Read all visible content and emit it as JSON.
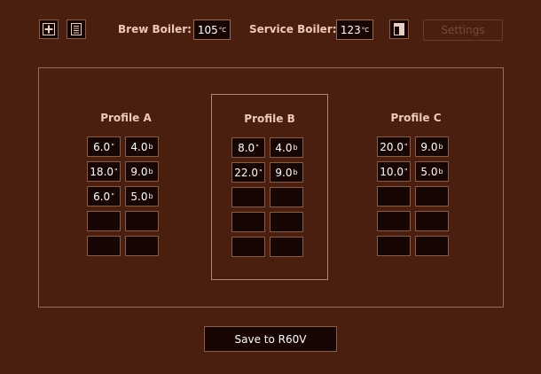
{
  "toolbar": {
    "add_icon": "plus-icon",
    "list_icon": "list-icon",
    "brew_boiler_label": "Brew Boiler:",
    "brew_boiler_value": "105",
    "brew_boiler_unit": "°C",
    "service_boiler_label": "Service Boiler:",
    "service_boiler_value": "123",
    "service_boiler_unit": "°C",
    "panel_icon": "sidebar-panel-icon",
    "settings_label": "Settings"
  },
  "profiles": [
    {
      "title": "Profile A",
      "selected": false,
      "rows": [
        {
          "time": "6.0",
          "time_unit": "\"",
          "pressure": "4.0",
          "pressure_unit": "b"
        },
        {
          "time": "18.0",
          "time_unit": "\"",
          "pressure": "9.0",
          "pressure_unit": "b"
        },
        {
          "time": "6.0",
          "time_unit": "\"",
          "pressure": "5.0",
          "pressure_unit": "b"
        },
        {
          "time": "",
          "time_unit": "",
          "pressure": "",
          "pressure_unit": ""
        },
        {
          "time": "",
          "time_unit": "",
          "pressure": "",
          "pressure_unit": ""
        }
      ]
    },
    {
      "title": "Profile B",
      "selected": true,
      "rows": [
        {
          "time": "8.0",
          "time_unit": "\"",
          "pressure": "4.0",
          "pressure_unit": "b"
        },
        {
          "time": "22.0",
          "time_unit": "\"",
          "pressure": "9.0",
          "pressure_unit": "b"
        },
        {
          "time": "",
          "time_unit": "",
          "pressure": "",
          "pressure_unit": ""
        },
        {
          "time": "",
          "time_unit": "",
          "pressure": "",
          "pressure_unit": ""
        },
        {
          "time": "",
          "time_unit": "",
          "pressure": "",
          "pressure_unit": ""
        }
      ]
    },
    {
      "title": "Profile C",
      "selected": false,
      "rows": [
        {
          "time": "20.0",
          "time_unit": "\"",
          "pressure": "9.0",
          "pressure_unit": "b"
        },
        {
          "time": "10.0",
          "time_unit": "\"",
          "pressure": "5.0",
          "pressure_unit": "b"
        },
        {
          "time": "",
          "time_unit": "",
          "pressure": "",
          "pressure_unit": ""
        },
        {
          "time": "",
          "time_unit": "",
          "pressure": "",
          "pressure_unit": ""
        },
        {
          "time": "",
          "time_unit": "",
          "pressure": "",
          "pressure_unit": ""
        }
      ]
    }
  ],
  "save_label": "Save to R60V",
  "colors": {
    "background": "#4a1f10",
    "field": "#170604",
    "border": "#8a5a48",
    "label": "#f0c8b8"
  }
}
